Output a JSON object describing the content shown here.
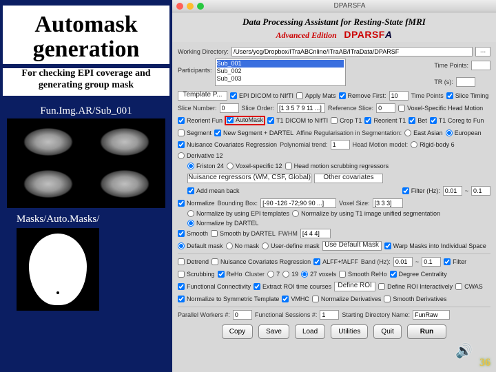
{
  "left": {
    "title": "Automask generation",
    "subtitle": "For checking EPI coverage and generating group mask",
    "caption1": "Fun.Img.AR/Sub_001",
    "caption2": "Masks/Auto.Masks/"
  },
  "win": {
    "title": "DPARSFA",
    "heading": "Data Processing Assistant for Resting-State fMRI",
    "edition": "Advanced Edition",
    "logo": "DPARSF",
    "logoA": "A"
  },
  "wd": {
    "label": "Working Directory:",
    "value": "/Users/ycg/Dropbox/ITraABCnline/ITraAB/ITraData/DPARSF",
    "dots": "..."
  },
  "participants": {
    "label": "Participants:",
    "items": [
      "Sub_001",
      "Sub_002",
      "Sub_003"
    ]
  },
  "tp": {
    "label": "Time Points:",
    "value": ""
  },
  "tr": {
    "label": "TR (s):",
    "value": ""
  },
  "row1": {
    "template": "Template P...",
    "epi2nifti": "EPI DICOM to NIfTI",
    "applymats": "Apply Mats",
    "removefirst": "Remove First:",
    "removefirst_val": "10",
    "tpnum": "Time Points",
    "slicetiming": "Slice Timing"
  },
  "row2": {
    "slicenum": "Slice Number:",
    "slicenum_val": "0",
    "sliceorder": "Slice Order:",
    "sliceorder_val": "[1 3 5 7 9 11 ...]",
    "refslice": "Reference Slice:",
    "refslice_val": "0",
    "voxhm": "Voxel-Specific Head Motion"
  },
  "row3": {
    "reorient": "Reorient Fun",
    "automask": "AutoMask",
    "t1nifti": "T1 DICOM to NIfTI",
    "cropt1": "Crop T1",
    "reorientt1": "Reorient T1",
    "bet": "Bet",
    "t1coreg": "T1 Coreg to Fun"
  },
  "row4": {
    "segment": "Segment",
    "newseg": "New Segment + DARTEL",
    "affine": "Affine Regularisation in Segmentation:",
    "eastasian": "East Asian",
    "european": "European"
  },
  "row5": {
    "nuisance": "Nuisance Covariates Regression",
    "poly": "Polynomial trend:",
    "poly_val": "1",
    "hmmodel": "Head Motion model:",
    "rigid": "Rigid-body 6",
    "deriv": "Derivative 12"
  },
  "row6": {
    "friston": "Friston 24",
    "vox12": "Voxel-specific 12",
    "scrub": "Head motion scrubbing regressors"
  },
  "row7": {
    "wmcsf": "Nuisance regressors (WM, CSF, Global)",
    "other": "Other covariates"
  },
  "row8": {
    "addmean": "Add mean back",
    "filter": "Filter (Hz):",
    "f1": "0.01",
    "tilde": "~",
    "f2": "0.1"
  },
  "row9": {
    "normalize": "Normalize",
    "bb": "Bounding Box:",
    "bb_val": "[-90 -126 -72;90 90 ...]",
    "vs": "Voxel Size:",
    "vs_val": "[3 3 3]"
  },
  "row10": {
    "epi": "Normalize by using EPI templates",
    "t1seg": "Normalize by using T1 image unified segmentation",
    "dartel": "Normalize by DARTEL"
  },
  "row11": {
    "smooth": "Smooth",
    "sdartel": "Smooth by DARTEL",
    "fwhm": "FWHM",
    "fwhm_val": "[4 4 4]"
  },
  "row12": {
    "defmask": "Default mask",
    "nomask": "No mask",
    "usermask": "User-define mask",
    "usebtn": "Use Default Mask",
    "warp": "Warp Masks into Individual Space"
  },
  "row13": {
    "detrend": "Detrend",
    "ncr": "Nuisance Covariates Regression",
    "alff": "ALFF+fALFF",
    "band": "Band (Hz):",
    "b1": "0.01",
    "tilde": "~",
    "b2": "0.1",
    "filter": "Filter"
  },
  "row14": {
    "scrub": "Scrubbing",
    "reho": "ReHo",
    "cluster": "Cluster",
    "c7": "7",
    "c19": "19",
    "c27": "27 voxels",
    "sreho": "Smooth ReHo",
    "dc": "Degree Centrality"
  },
  "row15": {
    "fc": "Functional Connectivity",
    "roi": "Extract ROI time courses",
    "defroi": "Define ROI",
    "defroi2": "Define ROI Interactively",
    "cwas": "CWAS"
  },
  "row16": {
    "norm": "Normalize to Symmetric Template",
    "vmhc": "VMHC",
    "nd": "Normalize Derivatives",
    "sd": "Smooth Derivatives"
  },
  "row17": {
    "pw": "Parallel Workers #:",
    "pw_val": "0",
    "fs": "Functional Sessions #:",
    "fs_val": "1",
    "sd": "Starting Directory Name:",
    "sd_val": "FunRaw"
  },
  "buttons": {
    "copy": "Copy",
    "save": "Save",
    "load": "Load",
    "util": "Utilities",
    "quit": "Quit",
    "run": "Run"
  },
  "page": "36"
}
